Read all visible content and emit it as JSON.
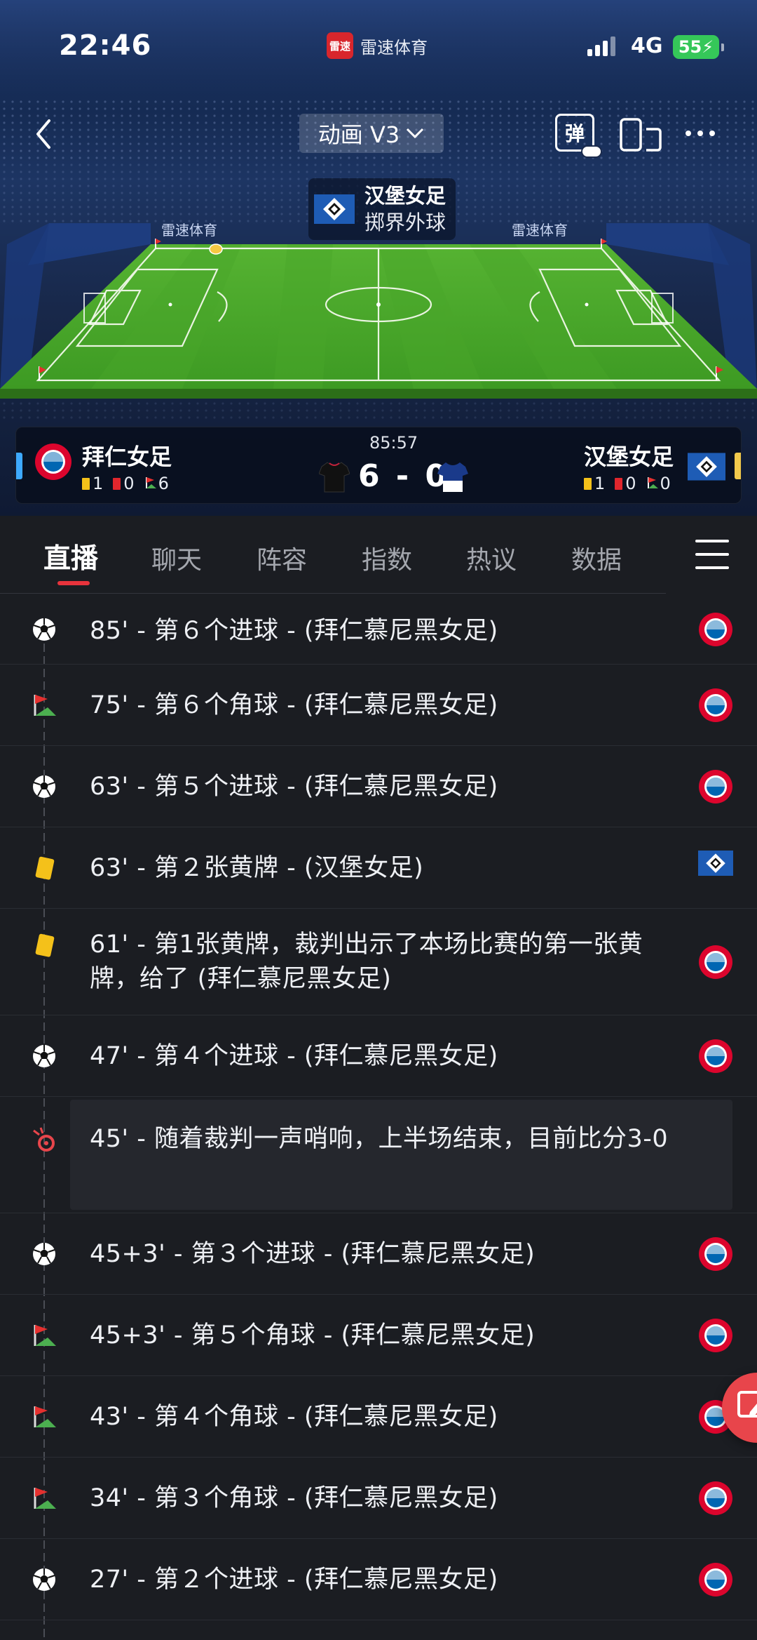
{
  "status_bar": {
    "time": "22:46",
    "app_name": "雷速体育",
    "app_logo_text": "雷速",
    "network": "4G",
    "battery": "55"
  },
  "header": {
    "mode_label": "动画 V3",
    "danmu_label": "弹"
  },
  "event_tag": {
    "team": "汉堡女足",
    "event": "掷界外球"
  },
  "pitch": {
    "board_text": "雷速体育"
  },
  "match": {
    "clock": "85:57",
    "score": "6 - 0",
    "home": {
      "name": "拜仁女足",
      "yellow": "1",
      "red": "0",
      "corners": "6",
      "accent": "#3da9ff"
    },
    "away": {
      "name": "汉堡女足",
      "yellow": "1",
      "red": "0",
      "corners": "0",
      "accent": "#f2c94c"
    }
  },
  "tabs": [
    {
      "label": "直播",
      "active": true
    },
    {
      "label": "聊天"
    },
    {
      "label": "阵容"
    },
    {
      "label": "指数"
    },
    {
      "label": "热议"
    },
    {
      "label": "数据"
    }
  ],
  "events": [
    {
      "type": "goal-icon",
      "text": "85' - 第６个进球 - (拜仁慕尼黑女足)",
      "team": "bayern"
    },
    {
      "type": "corner-icon",
      "text": "75' - 第６个角球 - (拜仁慕尼黑女足)",
      "team": "bayern"
    },
    {
      "type": "goal-icon",
      "text": "63' - 第５个进球 - (拜仁慕尼黑女足)",
      "team": "bayern"
    },
    {
      "type": "yellow-card-icon",
      "text": "63' - 第２张黄牌 - (汉堡女足)",
      "team": "hsv"
    },
    {
      "type": "yellow-card-icon",
      "text": "61' - 第1张黄牌，裁判出示了本场比赛的第一张黄牌，给了 (拜仁慕尼黑女足)",
      "team": "bayern"
    },
    {
      "type": "goal-icon",
      "text": "47' - 第４个进球 - (拜仁慕尼黑女足)",
      "team": "bayern"
    },
    {
      "type": "whistle-icon",
      "text": "45' - 随着裁判一声哨响，上半场结束，目前比分3-0",
      "team": ""
    },
    {
      "type": "goal-icon",
      "text": "45+3' - 第３个进球 - (拜仁慕尼黑女足)",
      "team": "bayern"
    },
    {
      "type": "corner-icon",
      "text": "45+3' - 第５个角球 - (拜仁慕尼黑女足)",
      "team": "bayern"
    },
    {
      "type": "corner-icon",
      "text": "43' - 第４个角球 - (拜仁慕尼黑女足)",
      "team": "bayern"
    },
    {
      "type": "corner-icon",
      "text": "34' - 第３个角球 - (拜仁慕尼黑女足)",
      "team": "bayern"
    },
    {
      "type": "goal-icon",
      "text": "27' - 第２个进球 - (拜仁慕尼黑女足)",
      "team": "bayern"
    }
  ],
  "colors": {
    "accent_red": "#e8333c",
    "background": "#1b1d22",
    "pitch_green": "#4caf2a"
  }
}
